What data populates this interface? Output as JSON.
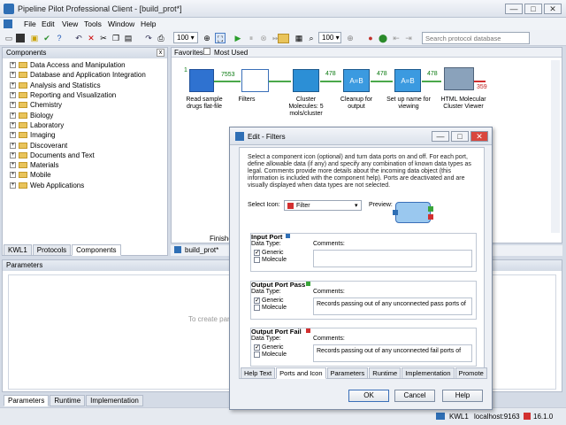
{
  "window": {
    "title": "Pipeline Pilot Professional Client - [build_prot*]",
    "min": "—",
    "max": "□",
    "close": "✕"
  },
  "menu": [
    "File",
    "Edit",
    "View",
    "Tools",
    "Window",
    "Help"
  ],
  "toolbar": {
    "zoom1": "100",
    "zoom2": "100",
    "search_placeholder": "Search protocol database"
  },
  "components": {
    "header": "Components",
    "close": "x",
    "items": [
      "Data Access and Manipulation",
      "Database and Application Integration",
      "Analysis and Statistics",
      "Reporting and Visualization",
      "Chemistry",
      "Biology",
      "Laboratory",
      "Imaging",
      "Discoverant",
      "Documents and Text",
      "Materials",
      "Mobile",
      "Web Applications"
    ],
    "tabs": [
      "KWL1",
      "Protocols",
      "Components"
    ]
  },
  "canvas": {
    "tabs": [
      "Favorites",
      "Most Used"
    ],
    "nodes": [
      {
        "label": "Read sample\ndrugs flat-file",
        "count": "7553"
      },
      {
        "label": "Filters",
        "count": ""
      },
      {
        "label": "Cluster\nMolecules: 5\nmols/cluster",
        "count": "478"
      },
      {
        "label": "Cleanup for\noutput",
        "count": "478"
      },
      {
        "label": "Set up name for\nviewing",
        "count": "478"
      },
      {
        "label": "HTML Molecular\nCluster Viewer",
        "count": "478"
      }
    ],
    "start_num": "1",
    "fail_count": "359",
    "status_text": "Finishe",
    "bottom_tab": "build_prot*"
  },
  "parameters": {
    "header": "Parameters",
    "hint": "To create para",
    "tabs": [
      "Parameters",
      "Runtime",
      "Implementation"
    ]
  },
  "statusbar": {
    "user": "KWL1",
    "server": "localhost:9163",
    "version": "16.1.0"
  },
  "dialog": {
    "title": "Edit - Filters",
    "description": "Select a component icon (optional) and turn data ports on and off.  For each port, define allowable data (if any) and specify any combination of known data types as legal.  Comments provide more details about the incoming data object (this information is included with the component help).  Ports are deactivated and are visually displayed when data types are not selected.",
    "select_icon_label": "Select Icon:",
    "select_icon_value": "Filter",
    "preview_label": "Preview:",
    "input_port": {
      "title": "Input Port",
      "data_type_label": "Data Type:",
      "comments_label": "Comments:",
      "types": [
        {
          "name": "Generic",
          "checked": true
        },
        {
          "name": "Molecule",
          "checked": false
        }
      ],
      "comment": ""
    },
    "pass_port": {
      "title": "Output Port Pass",
      "data_type_label": "Data Type:",
      "comments_label": "Comments:",
      "types": [
        {
          "name": "Generic",
          "checked": true
        },
        {
          "name": "Molecule",
          "checked": false
        }
      ],
      "comment": "Records passing out of any unconnected pass ports of"
    },
    "fail_port": {
      "title": "Output Port Fail",
      "data_type_label": "Data Type:",
      "comments_label": "Comments:",
      "types": [
        {
          "name": "Generic",
          "checked": true
        },
        {
          "name": "Molecule",
          "checked": false
        }
      ],
      "comment": "Records passing out of any unconnected fail ports of"
    },
    "tabs": [
      "Help Text",
      "Ports and Icon",
      "Parameters",
      "Runtime",
      "Implementation",
      "Promote"
    ],
    "ok": "OK",
    "cancel": "Cancel",
    "help": "Help"
  },
  "colors": {
    "accent": "#2f6fb5",
    "pass_port": "#3aa53a",
    "fail_port": "#d23030"
  }
}
